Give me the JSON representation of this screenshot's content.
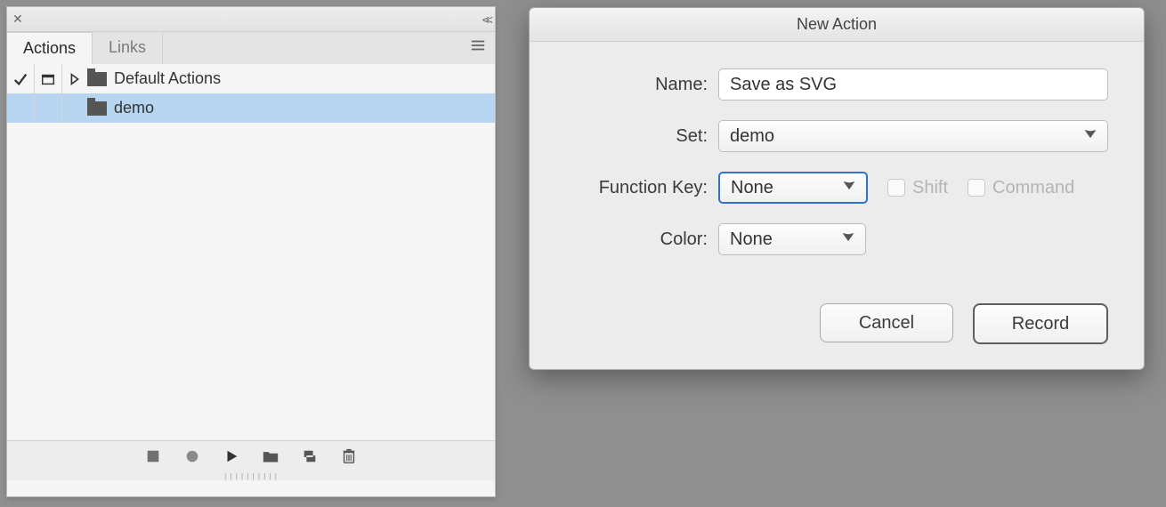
{
  "panel": {
    "tabs": [
      {
        "label": "Actions",
        "active": true
      },
      {
        "label": "Links",
        "active": false
      }
    ],
    "tree": [
      {
        "label": "Default Actions",
        "checked": true,
        "dialog": true,
        "expandable": true,
        "selected": false
      },
      {
        "label": "demo",
        "checked": false,
        "dialog": false,
        "expandable": false,
        "selected": true
      }
    ]
  },
  "dialog": {
    "title": "New Action",
    "fields": {
      "name": {
        "label": "Name:",
        "value": "Save as SVG"
      },
      "set": {
        "label": "Set:",
        "value": "demo"
      },
      "function_key": {
        "label": "Function Key:",
        "value": "None",
        "shift_label": "Shift",
        "command_label": "Command"
      },
      "color": {
        "label": "Color:",
        "value": "None"
      }
    },
    "buttons": {
      "cancel": "Cancel",
      "record": "Record"
    }
  }
}
